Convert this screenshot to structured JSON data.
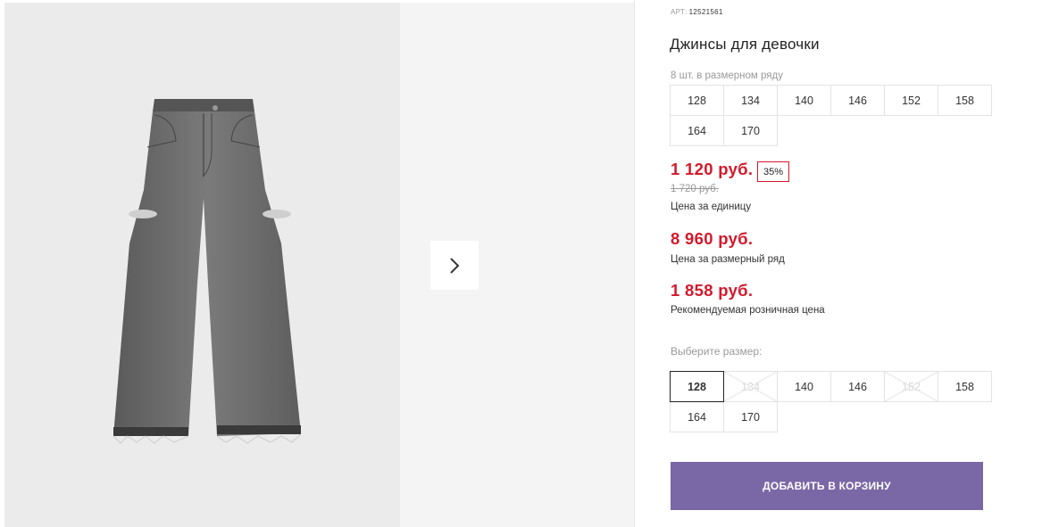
{
  "product": {
    "art_label": "АРТ:",
    "art_number": "12521561",
    "title": "Джинсы для девочки"
  },
  "size_row": {
    "caption": "8 шт. в размерном ряду",
    "sizes": [
      "128",
      "134",
      "140",
      "146",
      "152",
      "158",
      "164",
      "170"
    ]
  },
  "pricing": {
    "unit_price": "1 120 руб.",
    "discount": "35%",
    "old_price": "1 720 руб.",
    "unit_label": "Цена за единицу",
    "row_price": "8 960 руб.",
    "row_label": "Цена за размерный ряд",
    "retail_price": "1 858 руб.",
    "retail_label": "Рекомендуемая розничная цена"
  },
  "size_select": {
    "caption": "Выберите размер:",
    "options": [
      {
        "label": "128",
        "state": "selected"
      },
      {
        "label": "134",
        "state": "unavailable"
      },
      {
        "label": "140",
        "state": "available"
      },
      {
        "label": "146",
        "state": "available"
      },
      {
        "label": "152",
        "state": "unavailable"
      },
      {
        "label": "158",
        "state": "available"
      },
      {
        "label": "164",
        "state": "available"
      },
      {
        "label": "170",
        "state": "available"
      }
    ]
  },
  "cart_button": {
    "label": "ДОБАВИТЬ В КОРЗИНУ"
  },
  "gallery": {
    "next_icon": "chevron-right-icon"
  },
  "colors": {
    "price_red": "#d4192b",
    "button_purple": "#7a67a6",
    "photo_bg": "#ebebeb"
  }
}
